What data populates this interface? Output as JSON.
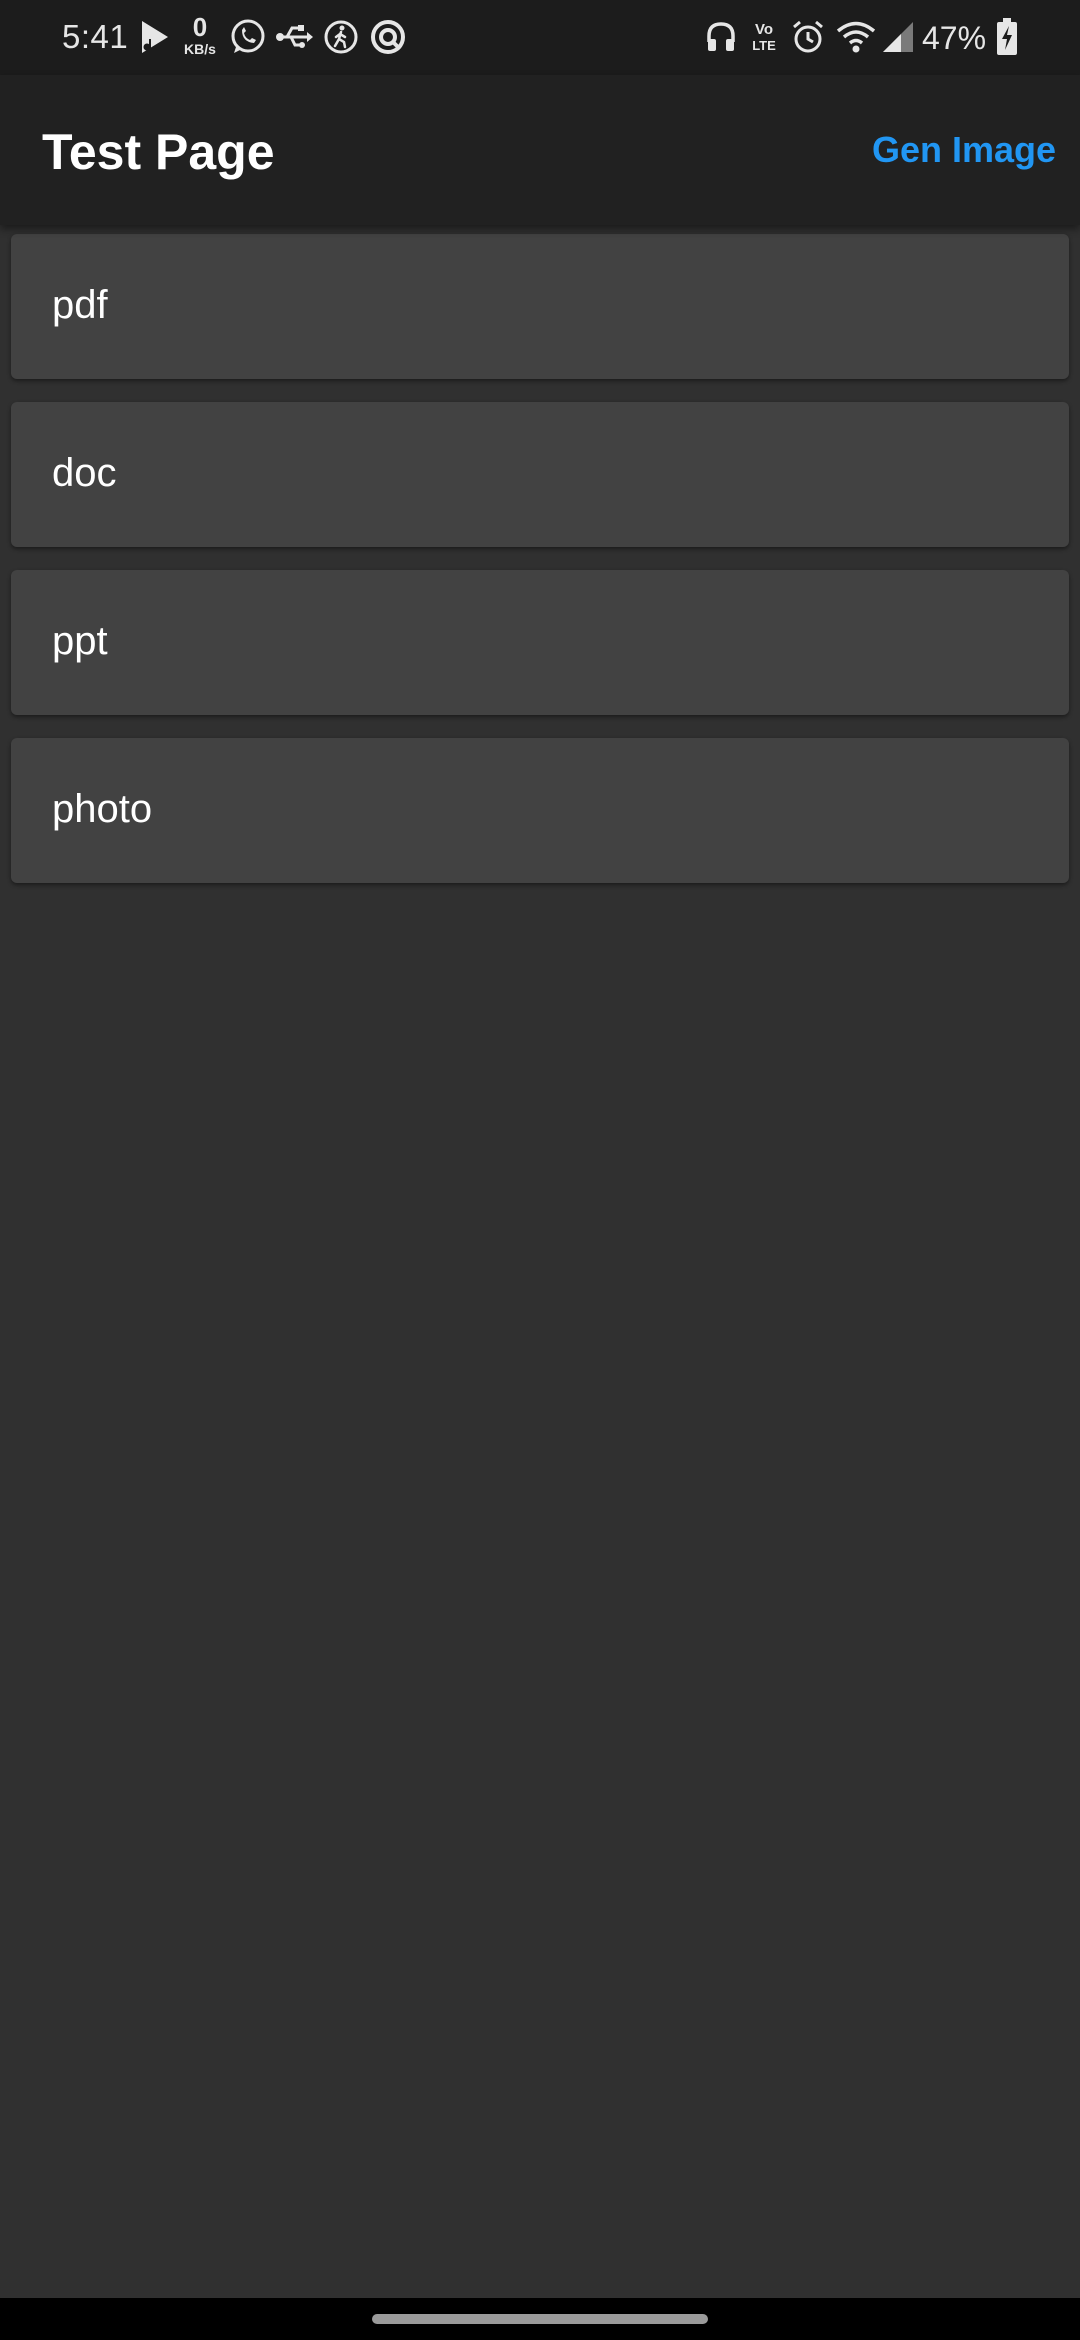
{
  "status_bar": {
    "time": "5:41",
    "net_speed_value": "0",
    "net_speed_unit": "KB/s",
    "volte_top": "Vo",
    "volte_bottom": "LTE",
    "battery_percent": "47%",
    "icons": [
      "play-store-icon",
      "whatsapp-icon",
      "usb-icon",
      "activity-icon",
      "app-icon",
      "headphones-icon",
      "alarm-icon",
      "wifi-icon",
      "signal-icon",
      "battery-charging-icon"
    ]
  },
  "app_bar": {
    "title": "Test Page",
    "action_label": "Gen Image",
    "action_color": "#2196f3"
  },
  "list": {
    "items": [
      {
        "label": "pdf"
      },
      {
        "label": "doc"
      },
      {
        "label": "ppt"
      },
      {
        "label": "photo"
      }
    ]
  }
}
